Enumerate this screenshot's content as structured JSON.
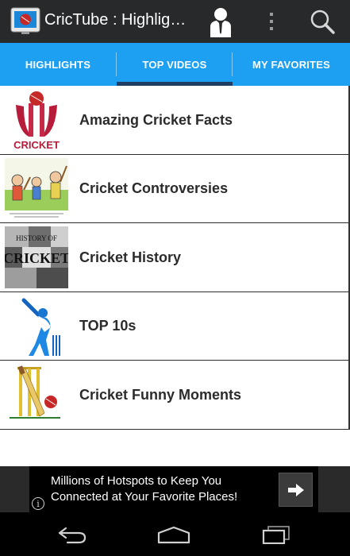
{
  "app": {
    "title": "CricTube : Highlights",
    "icon": "tv-cricket-icon"
  },
  "actionbar": {
    "icons": [
      "user-icon",
      "overflow-menu-icon",
      "search-icon"
    ]
  },
  "tabs": [
    {
      "label": "HIGHLIGHTS",
      "selected": false
    },
    {
      "label": "TOP VIDEOS",
      "selected": true
    },
    {
      "label": "MY FAVORITES",
      "selected": false
    }
  ],
  "list": [
    {
      "label": "Amazing Cricket Facts",
      "thumb": "cricket-logo-thumbnail",
      "thumb_text": "CRICKET"
    },
    {
      "label": "Cricket Controversies",
      "thumb": "cartoon-thumbnail"
    },
    {
      "label": "Cricket History",
      "thumb": "history-collage-thumbnail",
      "thumb_text": "HISTORY OF CRICKET"
    },
    {
      "label": "TOP 10s",
      "thumb": "batsman-silhouette-thumbnail"
    },
    {
      "label": "Cricket Funny Moments",
      "thumb": "bat-stumps-ball-thumbnail"
    }
  ],
  "ad": {
    "text": "Millions of Hotspots to Keep You Connected at Your Favorite Places!",
    "info_glyph": "i"
  },
  "navbar": {
    "icons": [
      "back-icon",
      "home-icon",
      "recent-apps-icon"
    ]
  },
  "colors": {
    "actionbar": "#27292b",
    "tabbar": "#1da0f2",
    "tab_indicator": "#1f3e63",
    "navbar": "#000000"
  }
}
